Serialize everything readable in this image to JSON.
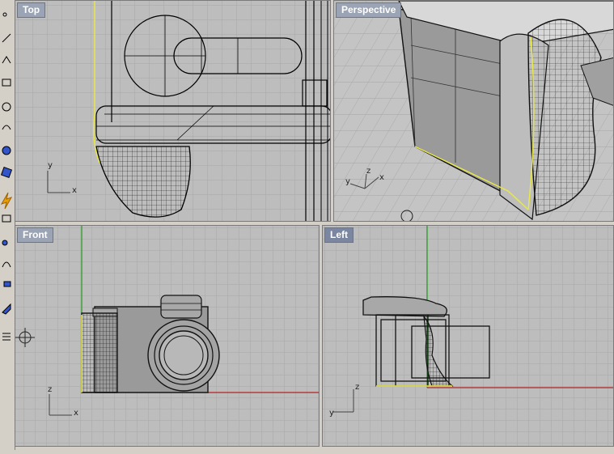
{
  "viewports": {
    "top": {
      "label": "Top",
      "axis_x": "x",
      "axis_y": "y"
    },
    "perspective": {
      "label": "Perspective",
      "axis_x": "x",
      "axis_y": "y",
      "axis_z": "z"
    },
    "front": {
      "label": "Front",
      "axis_x": "x",
      "axis_z": "z"
    },
    "left": {
      "label": "Left",
      "axis_y": "y",
      "axis_z": "z"
    }
  },
  "toolbar": {
    "tools": [
      "point-icon",
      "line-icon",
      "polyline-icon",
      "rectangle-icon",
      "circle-icon",
      "arc-icon",
      "curve-icon",
      "surface-icon",
      "solid-icon",
      "transform-icon",
      "analyze-icon",
      "render-icon",
      "mesh-icon",
      "dimension-icon",
      "snap-icon",
      "move-icon",
      "scale-icon",
      "light-icon"
    ]
  },
  "colors": {
    "grid_bg": "#bdbdbd",
    "grid_line": "#a8a8a8",
    "grid_major": "#8c8c8c",
    "x_axis": "#b22222",
    "y_axis": "#1e9e1e",
    "selection": "#e8e84a"
  }
}
